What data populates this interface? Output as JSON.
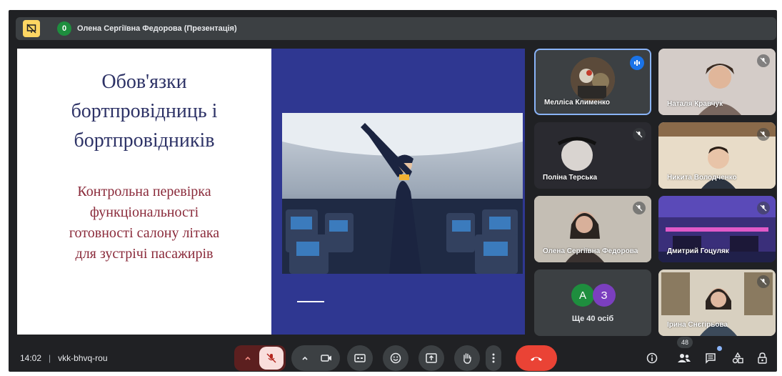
{
  "top_bar": {
    "presenter_count": "0",
    "presenter_label": "Олена Сергіївна Федорова (Презентація)"
  },
  "slide": {
    "title_lines": [
      "Обов'язки",
      "бортпровідниць і",
      "бортпровідників"
    ],
    "subtitle_lines": [
      "Контрольна перевірка",
      "функціональності",
      "готовності салону літака",
      "для зустрічі пасажирів"
    ]
  },
  "participants": [
    {
      "name": "Мелліса Клименко",
      "state": "speaking"
    },
    {
      "name": "Наталя Кравчук",
      "state": "muted"
    },
    {
      "name": "Поліна Терська",
      "state": "muted"
    },
    {
      "name": "Никита Володченко",
      "state": "muted"
    },
    {
      "name": "Олена Сергіївна Федорова",
      "state": "muted"
    },
    {
      "name": "Дмитрий Гоцуляк",
      "state": "muted"
    },
    {
      "name": "Ірина Снєгірьова",
      "state": "muted"
    }
  ],
  "others_tile": {
    "avatars": [
      {
        "letter": "А",
        "color": "#1e8e3e"
      },
      {
        "letter": "З",
        "color": "#7b3fbf"
      }
    ],
    "label": "Ще 40 осіб"
  },
  "bottom_bar": {
    "time": "14:02",
    "meeting_code": "vkk-bhvq-rou",
    "participant_count": "48"
  },
  "colors": {
    "background": "#202124",
    "control": "#3c4043",
    "mic_off": "#f9dedc",
    "end_call": "#ea4335",
    "slide_blue": "#2f3791",
    "title": "#2d3266",
    "subtitle": "#8a2a3a"
  }
}
